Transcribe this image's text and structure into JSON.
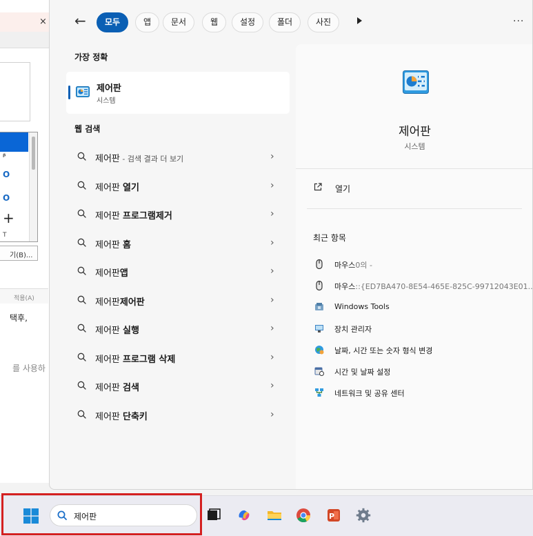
{
  "background_window": {
    "close_glyph": "×",
    "list_glyphs": [
      "ᵝ",
      "O",
      "O",
      "+",
      "T"
    ],
    "button_label": "기(B)...",
    "apply_label": "적용(A)",
    "text1": "택후,",
    "text2": "를 사용하"
  },
  "filters": {
    "back_glyph": "←",
    "tabs": [
      "모두",
      "앱",
      "문서",
      "웹",
      "설정",
      "폴더",
      "사진"
    ],
    "more_glyph": "···"
  },
  "best_match": {
    "section_title": "가장 정확",
    "name": "제어판",
    "type": "시스템"
  },
  "web_search": {
    "section_title": "웹 검색",
    "query": "제어판",
    "first_hint": " - 검색 결과 더 보기",
    "suggestions": [
      {
        "prefix": "제어판",
        "suffix": ""
      },
      {
        "prefix": "제어판 ",
        "suffix": "열기"
      },
      {
        "prefix": "제어판 ",
        "suffix": "프로그램제거"
      },
      {
        "prefix": "제어판 ",
        "suffix": "홈"
      },
      {
        "prefix": "제어판",
        "suffix": "앱"
      },
      {
        "prefix": "제어판",
        "suffix": "제어판"
      },
      {
        "prefix": "제어판 ",
        "suffix": "실행"
      },
      {
        "prefix": "제어판 ",
        "suffix": "프로그램 삭제"
      },
      {
        "prefix": "제어판 ",
        "suffix": "검색"
      },
      {
        "prefix": "제어판 ",
        "suffix": "단축키"
      }
    ],
    "chevron": "›"
  },
  "preview": {
    "name": "제어판",
    "type": "시스템",
    "open_label": "열기",
    "recent_title": "최근 항목",
    "recent_items": [
      {
        "label": "마우스",
        "muted": "0의 -",
        "icon": "mouse-icon"
      },
      {
        "label": "마우스",
        "muted": "::{ED7BA470-8E54-465E-825C-99712043E01...",
        "icon": "mouse-icon"
      },
      {
        "label": "Windows Tools",
        "muted": "",
        "icon": "windows-tools-icon"
      },
      {
        "label": "장치 관리자",
        "muted": "",
        "icon": "device-manager-icon"
      },
      {
        "label": "날짜, 시간 또는 숫자 형식 변경",
        "muted": "",
        "icon": "region-globe-icon"
      },
      {
        "label": "시간 및 날짜 설정",
        "muted": "",
        "icon": "date-time-icon"
      },
      {
        "label": "네트워크 및 공유 센터",
        "muted": "",
        "icon": "network-icon"
      }
    ]
  },
  "taskbar": {
    "search_text": "제어판",
    "apps": [
      "task-view-icon",
      "copilot-icon",
      "file-explorer-icon",
      "chrome-icon",
      "powerpoint-icon",
      "settings-icon"
    ]
  },
  "colors": {
    "accent": "#0a5fb4",
    "highlight_box": "#d42020"
  }
}
